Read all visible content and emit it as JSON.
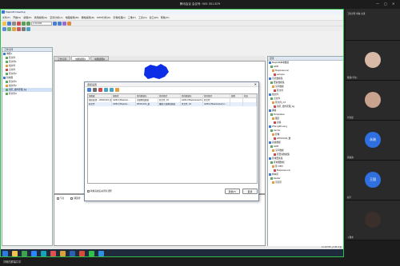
{
  "meeting": {
    "title": "腾讯会议 会议号: 505 351 879",
    "controls": [
      "—",
      "□",
      "✕"
    ],
    "footer_text": "刘琳的屏幕共享"
  },
  "app": {
    "title": "MapGIS Desktop",
    "menus": [
      "文件(F)",
      "开始(S)",
      "编辑(E)",
      "通用编辑(G)",
      "空间分析(A)",
      "地图编辑(M)",
      "栅格编辑(R)",
      "DEM分析(D)",
      "影像处理(I)",
      "三维(T)",
      "工具(O)",
      "窗口(W)",
      "帮助(H)"
    ],
    "scale_value": "1:50,000",
    "tabs": [
      "工作空间",
      "地图视图1",
      "地图视图2"
    ],
    "left_panel": {
      "title": "工作空间",
      "items": [
        "地图1",
        "区文件",
        "区文件1",
        "线文件",
        "点文件",
        "区文件2",
        "新地图",
        "区文件3",
        "线文件2",
        "新区_线作区图_bg",
        "区文件4"
      ]
    },
    "dialog": {
      "title": "连接设置",
      "close": "✕",
      "columns": [
        "源数据",
        "源路径",
        "目的数据名",
        "目的路径",
        "目的数据名",
        "目的路径",
        "参数",
        "状态"
      ],
      "rows": [
        [
          "图形处理 ...WD01004_数",
          "GDB:///MapGis/...",
          "全图叠加数据",
          "区文件_mt",
          "GDB:///MapGis/sw/Ln...",
          "区文件",
          "",
          ""
        ],
        [
          "原文件",
          "GDB:///MapGis...",
          "WD01004_数",
          "重数大规模化数据",
          "区文件_mt",
          "GDB:///MapGis/sw/Ln...",
          "",
          ""
        ]
      ],
      "checkbox_label": "转换完成后关闭对话框",
      "ok_label": "转换(F)",
      "cancel_label": "取消"
    },
    "bottom_panel": {
      "options": [
        "节点",
        "圆弧状",
        "坐标系统",
        "图形时间",
        "图形类别"
      ]
    },
    "right_panel": {
      "title": "目录",
      "items": [
        "MapGIS本地数据",
        "GDB",
        "MapGisLocal",
        "sample",
        "示范数据集",
        "要素数据集",
        "空间数据",
        "区文件",
        "线文件",
        "点文件",
        "区文件_mt",
        "新区_线作区图_bg",
        "栅格",
        "Templates",
        "图层",
        "表格",
        "ZhengZhuang",
        "Vector",
        "影像",
        "WD01004_数",
        "表格数据",
        "GDB",
        "空间数据",
        "区要素数据集",
        "区域要素集",
        "区地图数据",
        "区 DEM",
        "MapGisLocal",
        "样本区",
        "Raster",
        "示范区"
      ]
    },
    "status": "x=113.55, y=31.2 度",
    "taskbar_icons": [
      "start",
      "explorer",
      "browser",
      "tencent",
      "edge",
      "mapgis",
      "folder",
      "word",
      "wps",
      "chat",
      "qq"
    ]
  },
  "participants": [
    {
      "name": "卫生诊所 刘琳 主讲",
      "avatar": "photo"
    },
    {
      "name": "黎建(学生)",
      "avatar": "photo"
    },
    {
      "name": "付沈晨",
      "avatar": "photo"
    },
    {
      "name": "黄秋韵",
      "avatar": "text",
      "text": "永刚"
    },
    {
      "name": "赵宇",
      "avatar": "text",
      "text": "王国"
    },
    {
      "name": "卜雅丰",
      "avatar": "photo"
    }
  ],
  "colors": {
    "share_border": "#2fbf4a",
    "map_polygon": "#0c2ee6",
    "avatar_blue": "#2f6fe0"
  }
}
